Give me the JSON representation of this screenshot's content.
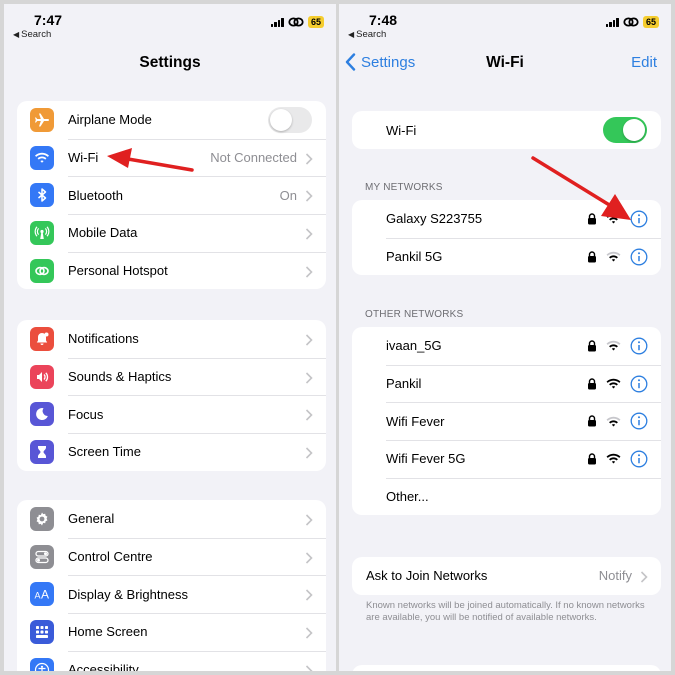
{
  "left": {
    "status": {
      "time": "7:47",
      "back_label": "Search",
      "battery": "65"
    },
    "title": "Settings",
    "groups": [
      [
        {
          "label": "Airplane Mode",
          "value": "",
          "icon": "airplane-icon",
          "color": "#f09a37"
        },
        {
          "label": "Wi-Fi",
          "value": "Not Connected",
          "icon": "wifi-icon",
          "color": "#3478f6"
        },
        {
          "label": "Bluetooth",
          "value": "On",
          "icon": "bluetooth-icon",
          "color": "#3478f6"
        },
        {
          "label": "Mobile Data",
          "value": "",
          "icon": "antenna-icon",
          "color": "#34c759"
        },
        {
          "label": "Personal Hotspot",
          "value": "",
          "icon": "hotspot-icon",
          "color": "#34c759"
        }
      ],
      [
        {
          "label": "Notifications",
          "icon": "bell-icon",
          "color": "#eb4e3d"
        },
        {
          "label": "Sounds & Haptics",
          "icon": "speaker-icon",
          "color": "#eb445a"
        },
        {
          "label": "Focus",
          "icon": "moon-icon",
          "color": "#5856d6"
        },
        {
          "label": "Screen Time",
          "icon": "hourglass-icon",
          "color": "#5856d6"
        }
      ],
      [
        {
          "label": "General",
          "icon": "gear-icon",
          "color": "#8e8e93"
        },
        {
          "label": "Control Centre",
          "icon": "switches-icon",
          "color": "#8e8e93"
        },
        {
          "label": "Display & Brightness",
          "icon": "text-size-icon",
          "color": "#3478f6"
        },
        {
          "label": "Home Screen",
          "icon": "grid-icon",
          "color": "#3a5bd9"
        },
        {
          "label": "Accessibility",
          "icon": "accessibility-icon",
          "color": "#3478f6"
        }
      ]
    ]
  },
  "right": {
    "status": {
      "time": "7:48",
      "back_label": "Search",
      "battery": "65"
    },
    "nav": {
      "back": "Settings",
      "title": "Wi-Fi",
      "edit": "Edit"
    },
    "wifi_label": "Wi-Fi",
    "my_networks_header": "MY NETWORKS",
    "my_networks": [
      "Galaxy S223755",
      "Pankil 5G"
    ],
    "other_networks_header": "OTHER NETWORKS",
    "other_networks": [
      "ivaan_5G",
      "Pankil",
      "Wifi Fever",
      "Wifi Fever 5G"
    ],
    "other_label": "Other...",
    "ask_join": {
      "label": "Ask to Join Networks",
      "value": "Notify"
    },
    "footer": "Known networks will be joined automatically. If no known networks are available, you will be notified of available networks."
  },
  "colors": {
    "accent": "#2d7fe0",
    "toggle_on": "#34c759",
    "annotation_arrow": "#e02020"
  }
}
